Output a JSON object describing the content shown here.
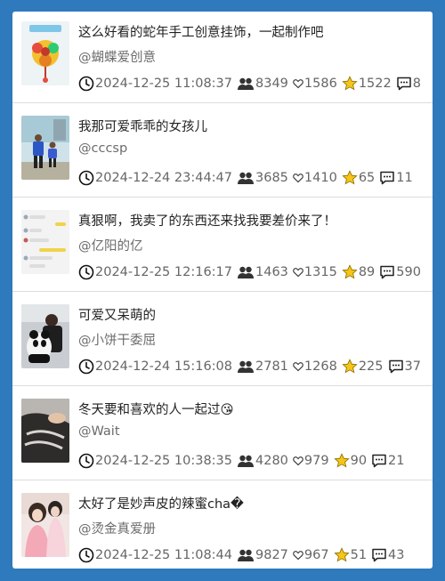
{
  "posts": [
    {
      "title": "这么好看的蛇年手工创意挂饰，一起制作吧",
      "author": "@蝴蝶爱创意",
      "time": "2024-12-25 11:08:37",
      "views": "8349",
      "likes": "1586",
      "favorites": "1522",
      "comments": "8"
    },
    {
      "title": "我那可爱乖乖的女孩儿",
      "author": "@cccsp",
      "time": "2024-12-24 23:44:47",
      "views": "3685",
      "likes": "1410",
      "favorites": "65",
      "comments": "11"
    },
    {
      "title": "真狠啊，我卖了的东西还来找我要差价来了！",
      "author": "@亿阳的亿",
      "time": "2024-12-25 12:16:17",
      "views": "1463",
      "likes": "1315",
      "favorites": "89",
      "comments": "590"
    },
    {
      "title": "可爱又呆萌的",
      "author": "@小饼干委屈",
      "time": "2024-12-24 15:16:08",
      "views": "2781",
      "likes": "1268",
      "favorites": "225",
      "comments": "37"
    },
    {
      "title": "冬天要和喜欢的人一起过😘",
      "author": "@Wait",
      "time": "2024-12-25 10:38:35",
      "views": "4280",
      "likes": "979",
      "favorites": "90",
      "comments": "21"
    },
    {
      "title": "太好了是妙声皮的辣蜜cha�",
      "author": "@烫金真爱册",
      "time": "2024-12-25 11:08:44",
      "views": "9827",
      "likes": "967",
      "favorites": "51",
      "comments": "43"
    }
  ]
}
